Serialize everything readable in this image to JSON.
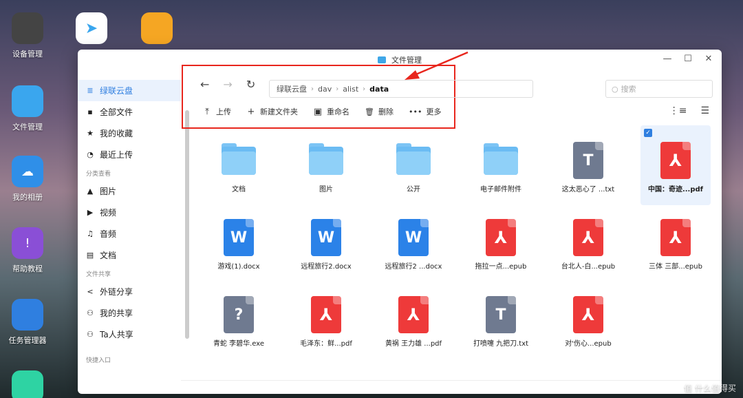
{
  "desktop": {
    "icons": [
      {
        "label": "设备管理",
        "color": "#3a3a3a"
      },
      {
        "label": "文件管理",
        "color": "#3aa6ee"
      },
      {
        "label": "我的相册",
        "color": "#2f8fe8"
      },
      {
        "label": "帮助教程",
        "color": "#8a4fd6"
      },
      {
        "label": "任务管理器",
        "color": "#2f7fe0"
      }
    ]
  },
  "window": {
    "title": "文件管理",
    "controls": [
      "—",
      "☐",
      "✕"
    ]
  },
  "sidebar": {
    "items": [
      {
        "label": "绿联云盘",
        "icon": "drive-icon",
        "glyph": "≣"
      },
      {
        "label": "全部文件",
        "icon": "file-icon",
        "glyph": "▪"
      },
      {
        "label": "我的收藏",
        "icon": "star-icon",
        "glyph": "★"
      },
      {
        "label": "最近上传",
        "icon": "clock-icon",
        "glyph": "◔"
      }
    ],
    "section_category": "分类查看",
    "category_items": [
      {
        "label": "图片",
        "icon": "image-icon",
        "glyph": "▲"
      },
      {
        "label": "视频",
        "icon": "video-icon",
        "glyph": "▶"
      },
      {
        "label": "音频",
        "icon": "headphones-icon",
        "glyph": "♫"
      },
      {
        "label": "文档",
        "icon": "document-icon",
        "glyph": "▤"
      }
    ],
    "section_share": "文件共享",
    "share_items": [
      {
        "label": "外链分享",
        "icon": "share-icon",
        "glyph": "<"
      },
      {
        "label": "我的共享",
        "icon": "users-icon",
        "glyph": "⚇"
      },
      {
        "label": "Ta人共享",
        "icon": "users-icon",
        "glyph": "⚇"
      }
    ],
    "section_quick": "快捷入口"
  },
  "nav": {
    "back": "←",
    "forward": "→",
    "refresh": "↻"
  },
  "breadcrumb": [
    "绿联云盘",
    "dav",
    "alist",
    "data"
  ],
  "search": {
    "placeholder": "搜索",
    "glyph": "○"
  },
  "actions": [
    {
      "label": "上传",
      "glyph": "⤒",
      "icon": "upload-icon"
    },
    {
      "label": "新建文件夹",
      "glyph": "+",
      "icon": "plus-icon"
    },
    {
      "label": "重命名",
      "glyph": "▣",
      "icon": "rename-icon"
    },
    {
      "label": "删除",
      "glyph": "🗑",
      "icon": "trash-icon"
    },
    {
      "label": "更多",
      "glyph": "•••",
      "icon": "more-icon"
    }
  ],
  "view": {
    "sort_glyph": "⋮≡",
    "list_glyph": "☰"
  },
  "files": [
    {
      "name": "文档",
      "type": "folder"
    },
    {
      "name": "图片",
      "type": "folder"
    },
    {
      "name": "公开",
      "type": "folder"
    },
    {
      "name": "电子邮件附件",
      "type": "folder"
    },
    {
      "name": "这太恶心了 ...txt",
      "type": "txt",
      "glyph": "T"
    },
    {
      "name": "中国：奇迹...pdf",
      "type": "pdf",
      "glyph": "⅄",
      "selected": true,
      "check": "✓"
    },
    {
      "name": "游戏(1).docx",
      "type": "word",
      "glyph": "W"
    },
    {
      "name": "远程旅行2.docx",
      "type": "word",
      "glyph": "W"
    },
    {
      "name": "远程旅行2 ...docx",
      "type": "word",
      "glyph": "W"
    },
    {
      "name": "拖拉一点...epub",
      "type": "pdf",
      "glyph": "⅄"
    },
    {
      "name": "台北人-白...epub",
      "type": "pdf",
      "glyph": "⅄"
    },
    {
      "name": "三体 三部...epub",
      "type": "pdf",
      "glyph": "⅄"
    },
    {
      "name": "青蛇 李碧华.exe",
      "type": "unk",
      "glyph": "?"
    },
    {
      "name": "毛泽东：鲜...pdf",
      "type": "pdf",
      "glyph": "⅄"
    },
    {
      "name": "黄祸 王力雄 ...pdf",
      "type": "pdf",
      "glyph": "⅄"
    },
    {
      "name": "打喷嚏 九把刀.txt",
      "type": "txt",
      "glyph": "T"
    },
    {
      "name": "对'伤心...epub",
      "type": "pdf",
      "glyph": "⅄"
    }
  ],
  "watermark": "值 什么值得买"
}
